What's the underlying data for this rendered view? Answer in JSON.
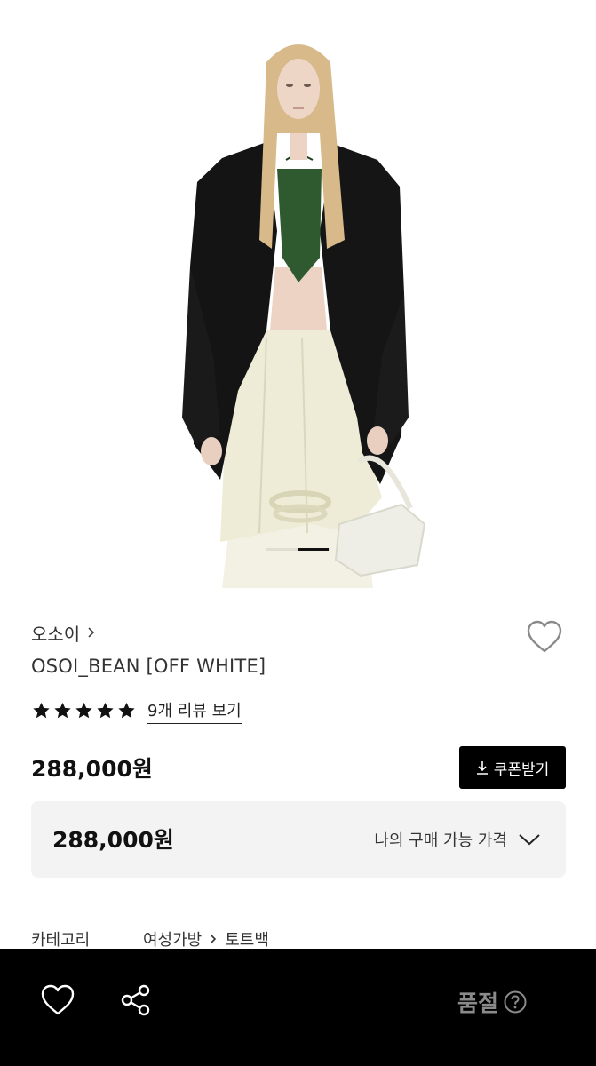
{
  "product": {
    "brand": "오소이",
    "name": "OSOI_BEAN [OFF WHITE]",
    "rating_stars": 5,
    "review_link": "9개 리뷰 보기",
    "price": "288,000원"
  },
  "coupon": {
    "label": "쿠폰받기",
    "icon": "download-icon"
  },
  "price_box": {
    "value": "288,000원",
    "label": "나의 구매 가능 가격",
    "icon": "chevron-down-icon"
  },
  "meta": {
    "category_label": "카테고리",
    "category_path": [
      "여성가방",
      "토트백"
    ]
  },
  "carousel": {
    "active_index": 1,
    "total": 2
  },
  "bottom_bar": {
    "status": "품절",
    "icons": [
      "heart-icon",
      "share-icon",
      "help-icon"
    ]
  },
  "colors": {
    "bottom_bar_bg": "#000000",
    "coupon_bg": "#000000",
    "price_box_bg": "#f3f3f3",
    "soldout_text": "#8a8a8a"
  }
}
